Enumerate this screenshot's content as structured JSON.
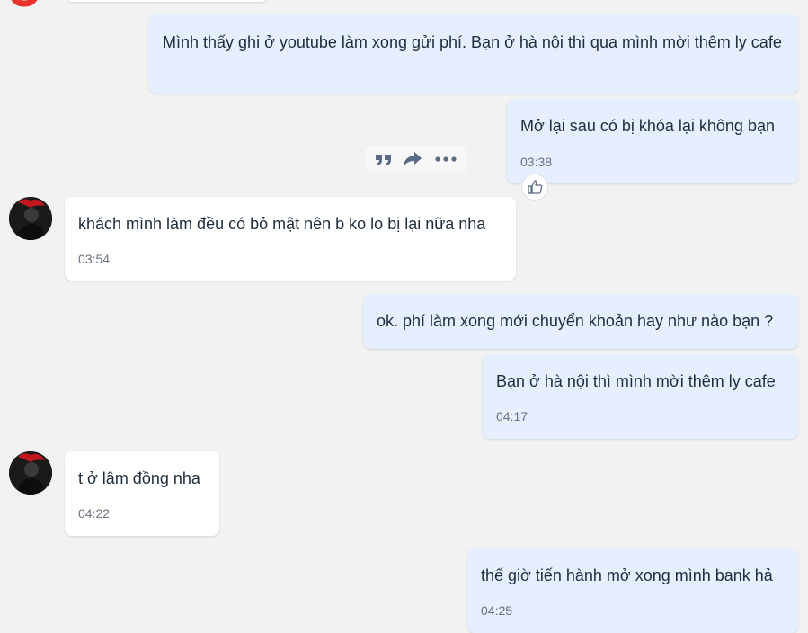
{
  "messages": [
    {
      "sender": "me",
      "text": "Mình thấy ghi ở youtube làm xong gửi phí. Bạn ở hà nội thì qua mình mời thêm ly cafe",
      "time": ""
    },
    {
      "sender": "me",
      "text": "Mở lại sau có bị khóa lại không bạn",
      "time": "03:38"
    },
    {
      "sender": "them",
      "text": "khách mình làm đều có bỏ mật nên b ko lo bị lại nữa nha",
      "time": "03:54"
    },
    {
      "sender": "me",
      "text": "ok. phí làm xong mới chuyển khoản hay như nào bạn ?",
      "time": ""
    },
    {
      "sender": "me",
      "text": "Bạn ở hà nội thì mình mời thêm ly cafe",
      "time": "04:17"
    },
    {
      "sender": "them",
      "text": "t ở lâm đồng nha",
      "time": "04:22"
    },
    {
      "sender": "me",
      "text": "thế giờ tiến hành mở xong mình bank hả",
      "time": "04:25"
    }
  ],
  "toolbar": {
    "icons": [
      "quote-icon",
      "forward-icon",
      "more-icon"
    ]
  },
  "reaction": {
    "icon": "thumbs-up-icon"
  },
  "colors": {
    "background": "#f2f2f2",
    "my_bubble": "#e5efff",
    "their_bubble": "#ffffff",
    "text": "#1f2d3d",
    "time": "#6b7280",
    "icon": "#5a6b85",
    "accent_red": "#e8322b"
  }
}
